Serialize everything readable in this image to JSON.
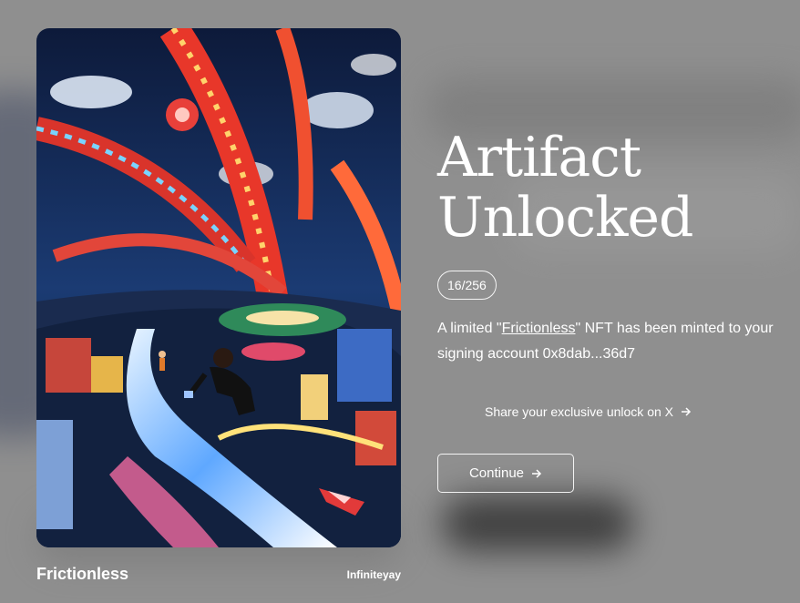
{
  "artwork": {
    "title": "Frictionless",
    "author": "Infiniteyay",
    "icon": "artwork-image"
  },
  "headline": {
    "line1": "Artifact",
    "line2": "Unlocked"
  },
  "edition": "16/256",
  "mint_message": {
    "prefix": "A limited \"",
    "nft_name": "Frictionless",
    "suffix": "\" NFT has been minted to your signing account 0x8dab...36d7"
  },
  "share": {
    "label": "Share your exclusive unlock on X",
    "icon": "arrow-right-icon"
  },
  "continue": {
    "label": "Continue",
    "icon": "arrow-right-icon"
  },
  "colors": {
    "background": "#8f8f8f",
    "text": "#ffffff"
  }
}
